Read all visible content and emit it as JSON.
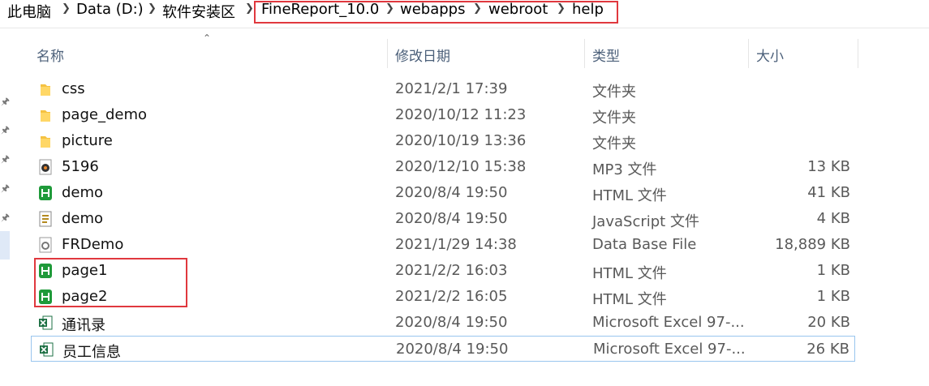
{
  "breadcrumb": {
    "items": [
      "此电脑",
      "Data (D:)",
      "软件安装区",
      "FineReport_10.0",
      "webapps",
      "webroot",
      "help"
    ]
  },
  "columns": {
    "name": "名称",
    "date": "修改日期",
    "type": "类型",
    "size": "大小"
  },
  "files": [
    {
      "name": "css",
      "date": "2021/2/1 17:39",
      "type": "文件夹",
      "size": "",
      "icon": "folder-icon"
    },
    {
      "name": "page_demo",
      "date": "2020/10/12 11:23",
      "type": "文件夹",
      "size": "",
      "icon": "folder-icon"
    },
    {
      "name": "picture",
      "date": "2020/10/19 13:36",
      "type": "文件夹",
      "size": "",
      "icon": "folder-icon"
    },
    {
      "name": "5196",
      "date": "2020/12/10 15:38",
      "type": "MP3 文件",
      "size": "13 KB",
      "icon": "mp3-file-icon"
    },
    {
      "name": "demo",
      "date": "2020/8/4 19:50",
      "type": "HTML 文件",
      "size": "41 KB",
      "icon": "html-file-icon"
    },
    {
      "name": "demo",
      "date": "2020/8/4 19:50",
      "type": "JavaScript 文件",
      "size": "4 KB",
      "icon": "js-file-icon"
    },
    {
      "name": "FRDemo",
      "date": "2021/1/29 14:38",
      "type": "Data Base File",
      "size": "18,889 KB",
      "icon": "db-file-icon"
    },
    {
      "name": "page1",
      "date": "2021/2/2 16:03",
      "type": "HTML 文件",
      "size": "1 KB",
      "icon": "html-file-icon"
    },
    {
      "name": "page2",
      "date": "2021/2/2 16:05",
      "type": "HTML 文件",
      "size": "1 KB",
      "icon": "html-file-icon"
    },
    {
      "name": "通讯录",
      "date": "2020/8/4 19:50",
      "type": "Microsoft Excel 97-...",
      "size": "20 KB",
      "icon": "excel-file-icon"
    },
    {
      "name": "员工信息",
      "date": "2020/8/4 19:50",
      "type": "Microsoft Excel 97-...",
      "size": "26 KB",
      "icon": "excel-file-icon"
    }
  ],
  "colors": {
    "highlight_box": "#e0383e",
    "folder": "#f5c242",
    "html_icon": "#1f9a3a",
    "excel_icon": "#1d7044",
    "header_text": "#4c607a"
  }
}
